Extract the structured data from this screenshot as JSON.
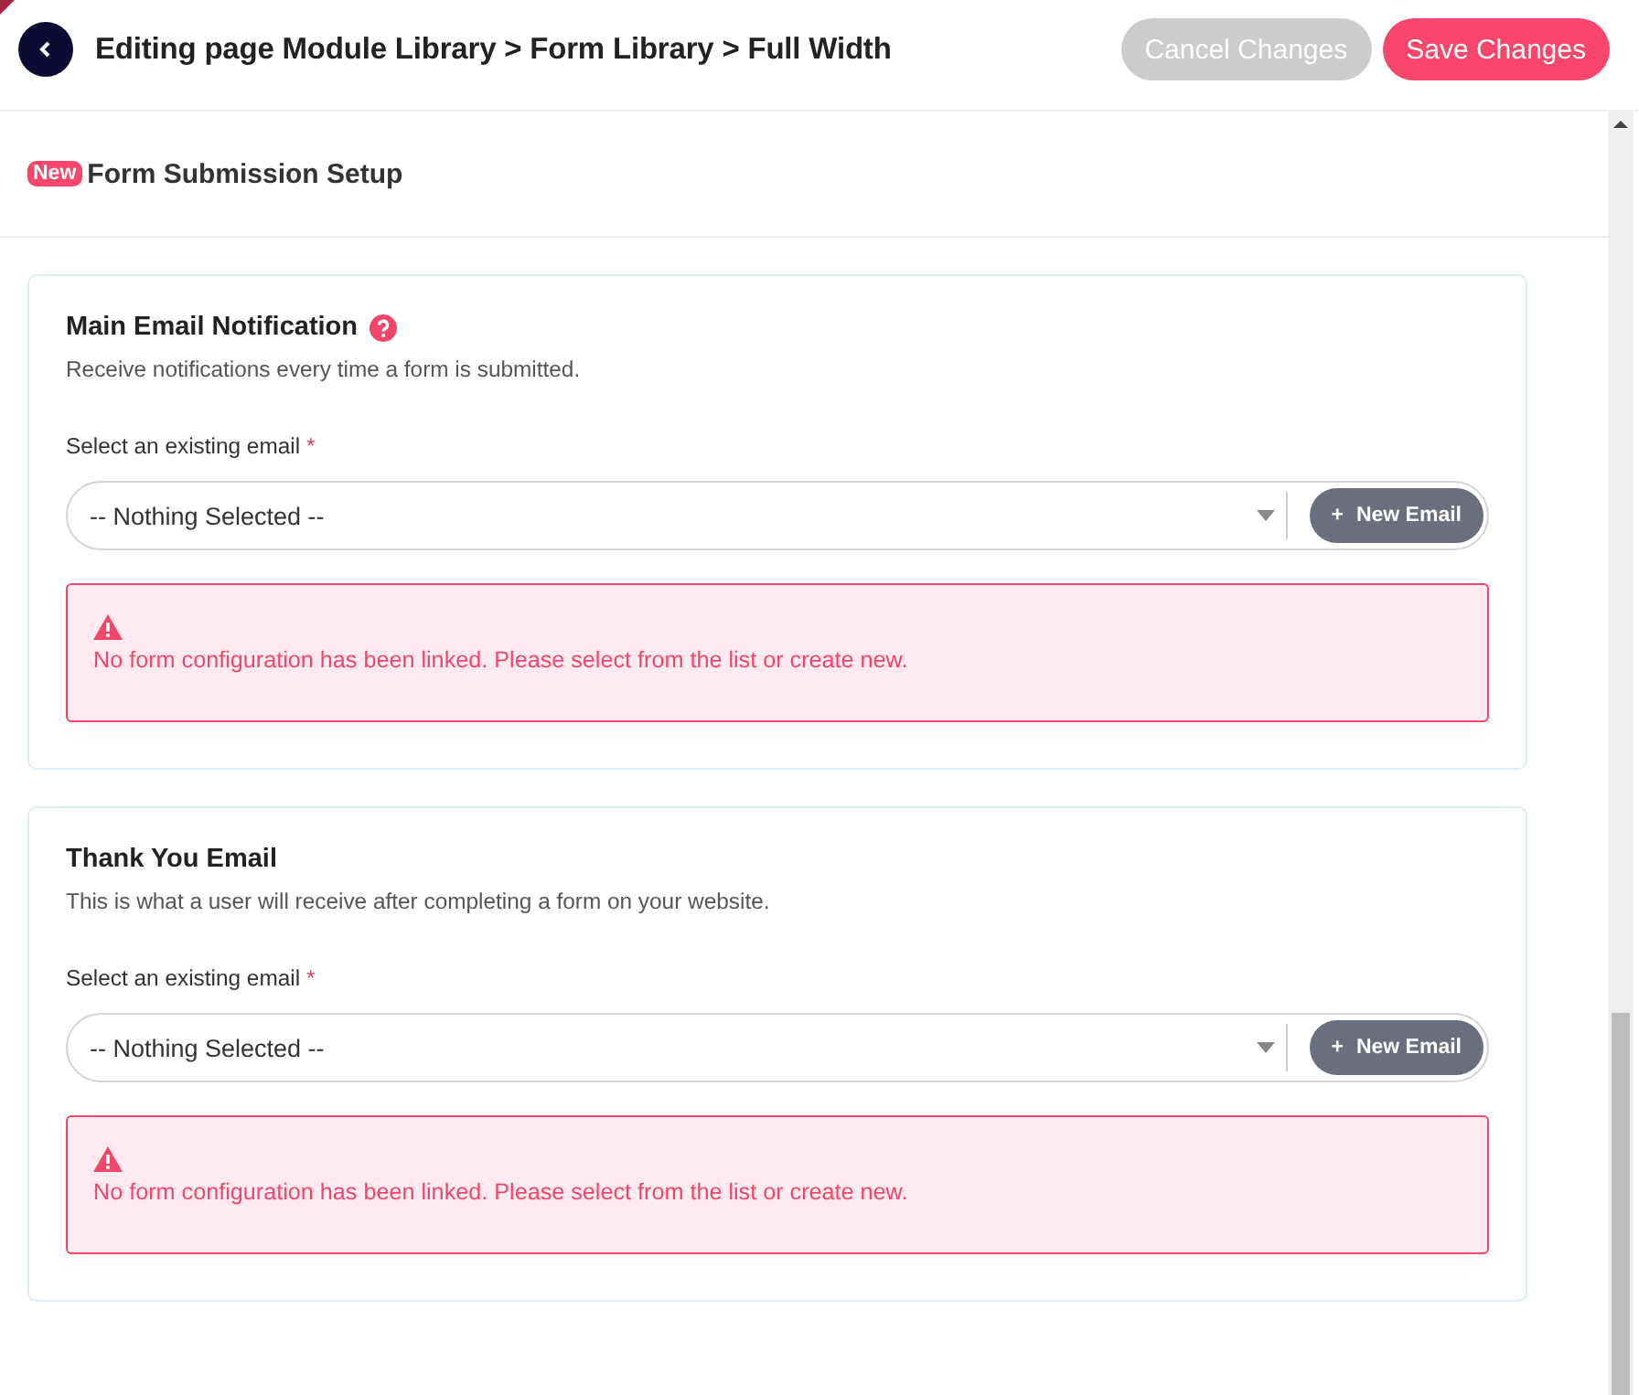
{
  "header": {
    "title": "Editing page Module Library > Form Library > Full Width",
    "buttons": [
      {
        "label": "Cancel Changes",
        "disabled": true
      },
      {
        "label": "Save Changes",
        "disabled": false
      }
    ]
  },
  "section": {
    "badge": "New",
    "title": "Form Submission Setup"
  },
  "cards": [
    {
      "title": "Main Email Notification",
      "help": true,
      "description": "Receive notifications every time a form is submitted.",
      "field_label": "Select an existing email",
      "required_mark": "*",
      "select_value": "-- Nothing Selected --",
      "new_button": "New Email",
      "new_icon": "+",
      "alert": "No form configuration has been linked. Please select from the list or create new."
    },
    {
      "title": "Thank You Email",
      "help": false,
      "description": "This is what a user will receive after completing a form on your website.",
      "field_label": "Select an existing email",
      "required_mark": "*",
      "select_value": "-- Nothing Selected --",
      "new_button": "New Email",
      "new_icon": "+",
      "alert": "No form configuration has been linked. Please select from the list or create new."
    }
  ]
}
